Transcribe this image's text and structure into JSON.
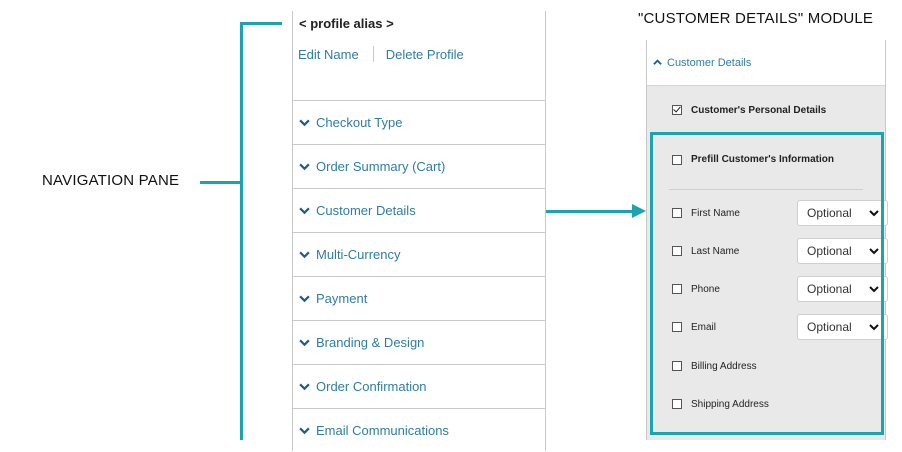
{
  "annotations": {
    "navigation_pane_label": "NAVIGATION PANE",
    "module_label": "\"CUSTOMER DETAILS\" MODULE",
    "accent_color": "#1aa3b0"
  },
  "nav": {
    "profile_alias": "< profile alias >",
    "edit_name": "Edit Name",
    "delete_profile": "Delete Profile",
    "items": [
      {
        "label": "Checkout Type",
        "icon": "chevron-down-icon"
      },
      {
        "label": "Order Summary (Cart)",
        "icon": "chevron-down-icon"
      },
      {
        "label": "Customer Details",
        "icon": "chevron-down-icon"
      },
      {
        "label": "Multi-Currency",
        "icon": "chevron-down-icon"
      },
      {
        "label": "Payment",
        "icon": "chevron-down-icon"
      },
      {
        "label": "Branding & Design",
        "icon": "chevron-down-icon"
      },
      {
        "label": "Order Confirmation",
        "icon": "chevron-down-icon"
      },
      {
        "label": "Email Communications",
        "icon": "chevron-down-icon"
      }
    ],
    "link_color": "#2e7ea6"
  },
  "module": {
    "header": "Customer Details",
    "header_icon": "chevron-up-icon",
    "personal_details": {
      "label": "Customer's Personal Details",
      "checked": true
    },
    "prefill": {
      "label": "Prefill Customer's Information",
      "checked": false
    },
    "fields": [
      {
        "label": "First Name",
        "checked": false,
        "option": "Optional"
      },
      {
        "label": "Last Name",
        "checked": false,
        "option": "Optional"
      },
      {
        "label": "Phone",
        "checked": false,
        "option": "Optional"
      },
      {
        "label": "Email",
        "checked": false,
        "option": "Optional"
      }
    ],
    "addresses": [
      {
        "label": "Billing Address",
        "checked": false
      },
      {
        "label": "Shipping Address",
        "checked": false
      }
    ]
  }
}
